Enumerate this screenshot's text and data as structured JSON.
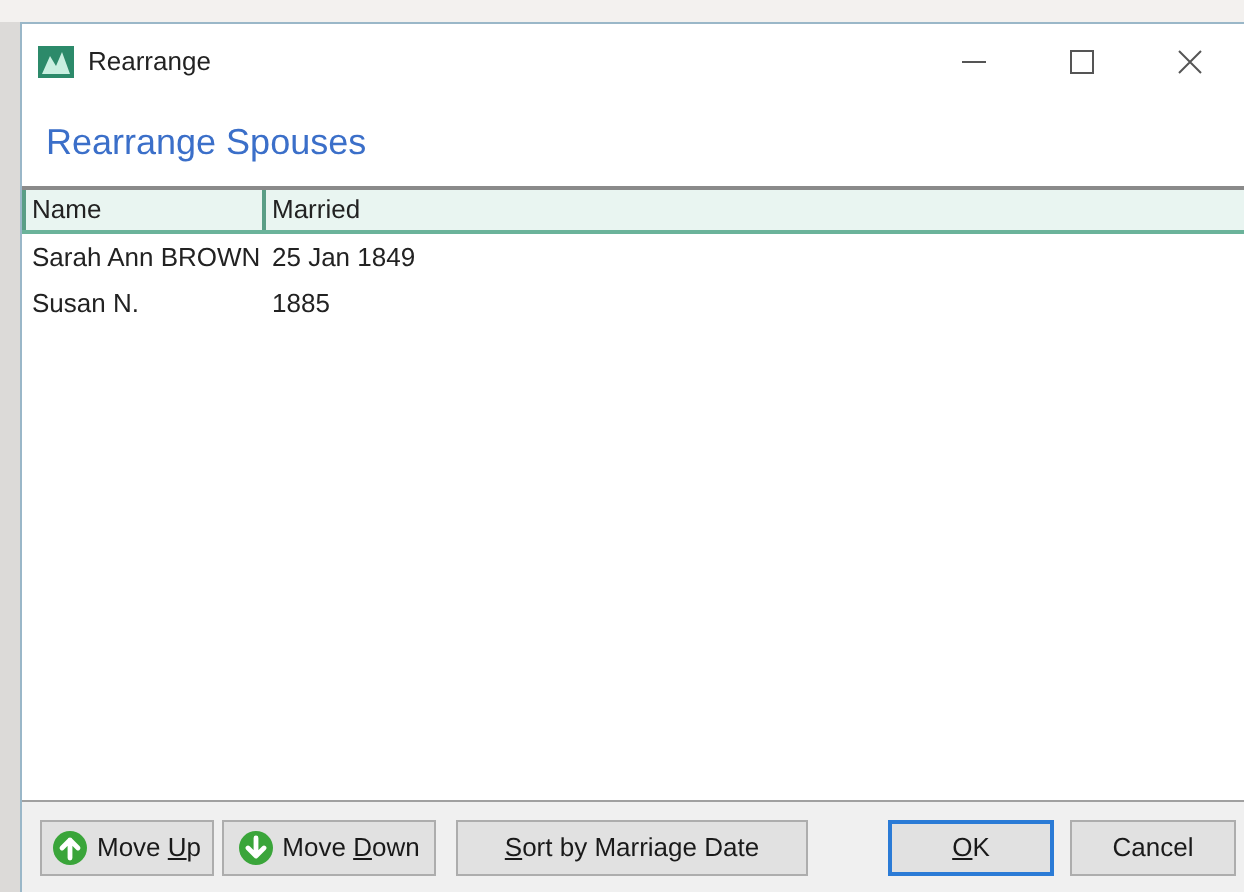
{
  "window": {
    "title": "Rearrange"
  },
  "heading": "Rearrange Spouses",
  "table": {
    "columns": [
      "Name",
      "Married"
    ],
    "rows": [
      {
        "cells": [
          "Sarah Ann BROWN",
          "25 Jan 1849"
        ],
        "selected": false
      },
      {
        "cells": [
          "Susan N.",
          "1885"
        ],
        "selected": false
      }
    ]
  },
  "buttons": [
    {
      "kind": "up",
      "label_before": "Move ",
      "access_key": "U",
      "label_after": "p",
      "default": false
    },
    {
      "kind": "down",
      "label_before": "Move ",
      "access_key": "D",
      "label_after": "own",
      "default": false
    },
    {
      "kind": "plain",
      "access_key": "S",
      "label_after": "ort by Marriage Date",
      "default": false
    },
    {
      "kind": "plain",
      "access_key": "O",
      "label_after": "K",
      "default": true
    },
    {
      "kind": "plain",
      "label_before": "Cancel",
      "default": false
    }
  ]
}
